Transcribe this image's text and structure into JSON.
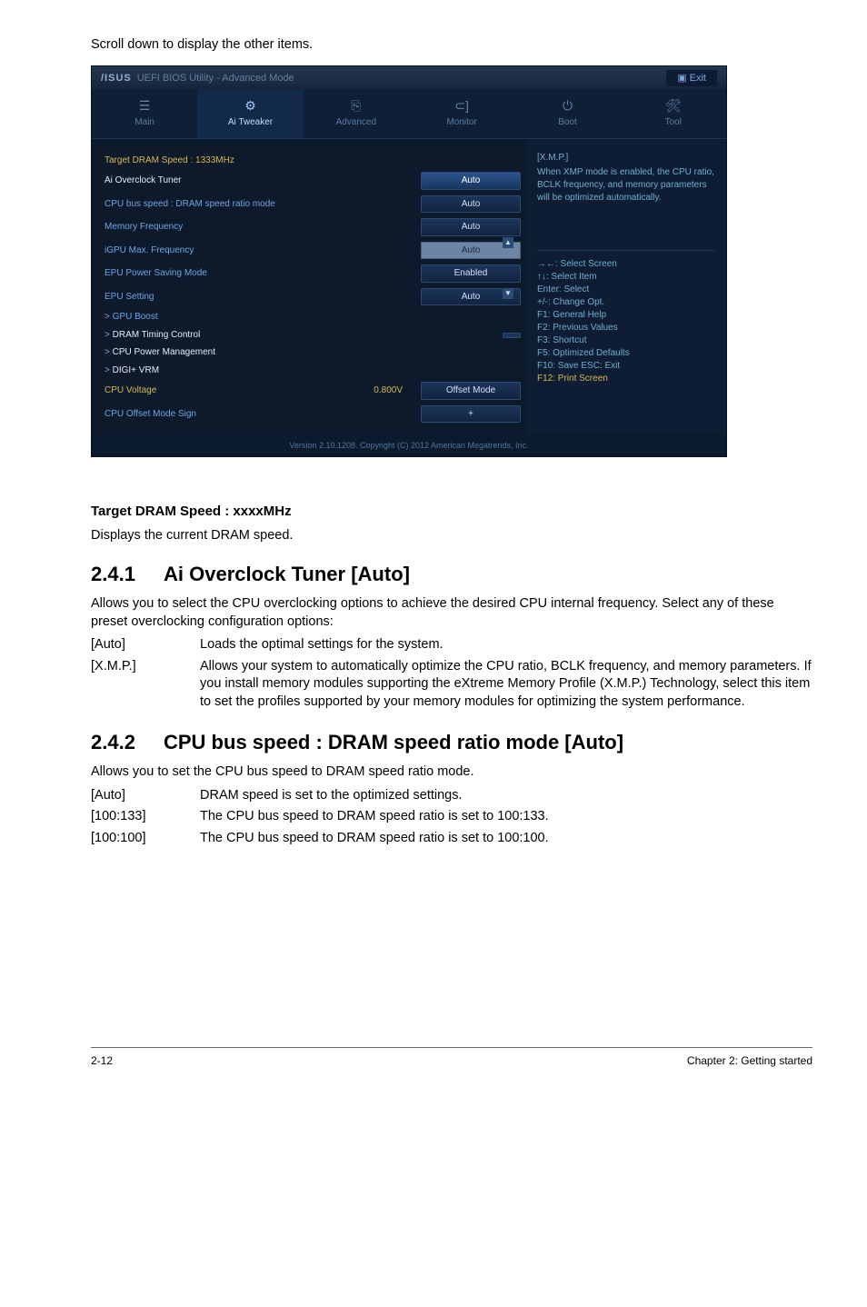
{
  "intro": "Scroll down to display the other items.",
  "bios": {
    "brand": "/ISUS",
    "title": "UEFI BIOS Utility - Advanced Mode",
    "exit": "Exit",
    "tabs": [
      {
        "icon": "☰",
        "label": "Main"
      },
      {
        "icon": "⚙",
        "label": "Ai Tweaker"
      },
      {
        "icon": "⎘",
        "label": "Advanced"
      },
      {
        "icon": "⊂]",
        "label": "Monitor"
      },
      {
        "icon": "⏻",
        "label": "Boot"
      },
      {
        "icon": "🛠",
        "label": "Tool"
      }
    ],
    "rows": [
      {
        "label": "Target DRAM Speed : 1333MHz",
        "style": "yellow",
        "field": null
      },
      {
        "label": "Ai Overclock Tuner",
        "style": "highlight",
        "field": "Auto",
        "selected": true
      },
      {
        "label": "CPU bus speed : DRAM speed ratio mode",
        "style": "blue",
        "field": "Auto"
      },
      {
        "label": "Memory Frequency",
        "style": "blue",
        "field": "Auto"
      },
      {
        "label": "iGPU Max. Frequency",
        "style": "blue",
        "field": "Auto",
        "input": true
      },
      {
        "label": "EPU Power Saving Mode",
        "style": "blue",
        "field": "Enabled"
      },
      {
        "label": "EPU Setting",
        "style": "blue",
        "field": "Auto"
      },
      {
        "label": "GPU Boost",
        "style": "blue",
        "field": null,
        "submenu": true
      },
      {
        "label": "DRAM Timing Control",
        "style": "highlight",
        "field": " ",
        "submenu": true
      },
      {
        "label": "CPU Power Management",
        "style": "highlight",
        "field": null,
        "submenu": true
      },
      {
        "label": "DIGI+ VRM",
        "style": "highlight",
        "field": null,
        "submenu": true
      },
      {
        "label": "CPU Voltage",
        "style": "yellow",
        "field": "Offset Mode",
        "value_left": "0.800V"
      },
      {
        "label": "CPU Offset Mode Sign",
        "style": "blue",
        "field": "+"
      }
    ],
    "help": {
      "title": "[X.M.P.]",
      "text": "When XMP mode is enabled, the CPU ratio, BCLK frequency, and memory parameters will be optimized automatically."
    },
    "keys": [
      "→←: Select Screen",
      "↑↓: Select Item",
      "Enter: Select",
      "+/-: Change Opt.",
      "F1: General Help",
      "F2: Previous Values",
      "F3: Shortcut",
      "F5: Optimized Defaults",
      "F10: Save  ESC: Exit",
      "F12: Print Screen"
    ],
    "footer": "Version 2.10.1208. Copyright (C) 2012 American Megatrends, Inc."
  },
  "target_dram": {
    "title": "Target DRAM Speed : xxxxMHz",
    "desc": "Displays the current DRAM speed."
  },
  "sec241": {
    "num": "2.4.1",
    "title": "Ai Overclock Tuner [Auto]",
    "body": "Allows you to select the CPU overclocking options to achieve the desired CPU internal frequency. Select any of these preset overclocking configuration options:",
    "options": [
      {
        "opt": "[Auto]",
        "desc": "Loads the optimal settings for the system."
      },
      {
        "opt": "[X.M.P.]",
        "desc": "Allows your system to automatically optimize the CPU ratio, BCLK frequency, and memory parameters. If you install memory modules supporting the eXtreme Memory Profile (X.M.P.) Technology, select this item to set the profiles supported by your memory modules for optimizing the system performance."
      }
    ]
  },
  "sec242": {
    "num": "2.4.2",
    "title": "CPU bus speed : DRAM speed ratio mode [Auto]",
    "body": "Allows you to set the CPU bus speed to DRAM speed ratio mode.",
    "options": [
      {
        "opt": "[Auto]",
        "desc": "DRAM speed is set to the optimized settings."
      },
      {
        "opt": "[100:133]",
        "desc": "The CPU bus speed to DRAM speed ratio is set to 100:133."
      },
      {
        "opt": "[100:100]",
        "desc": "The CPU bus speed to DRAM speed ratio is set to 100:100."
      }
    ]
  },
  "page_footer": {
    "left": "2-12",
    "right": "Chapter 2: Getting started"
  }
}
